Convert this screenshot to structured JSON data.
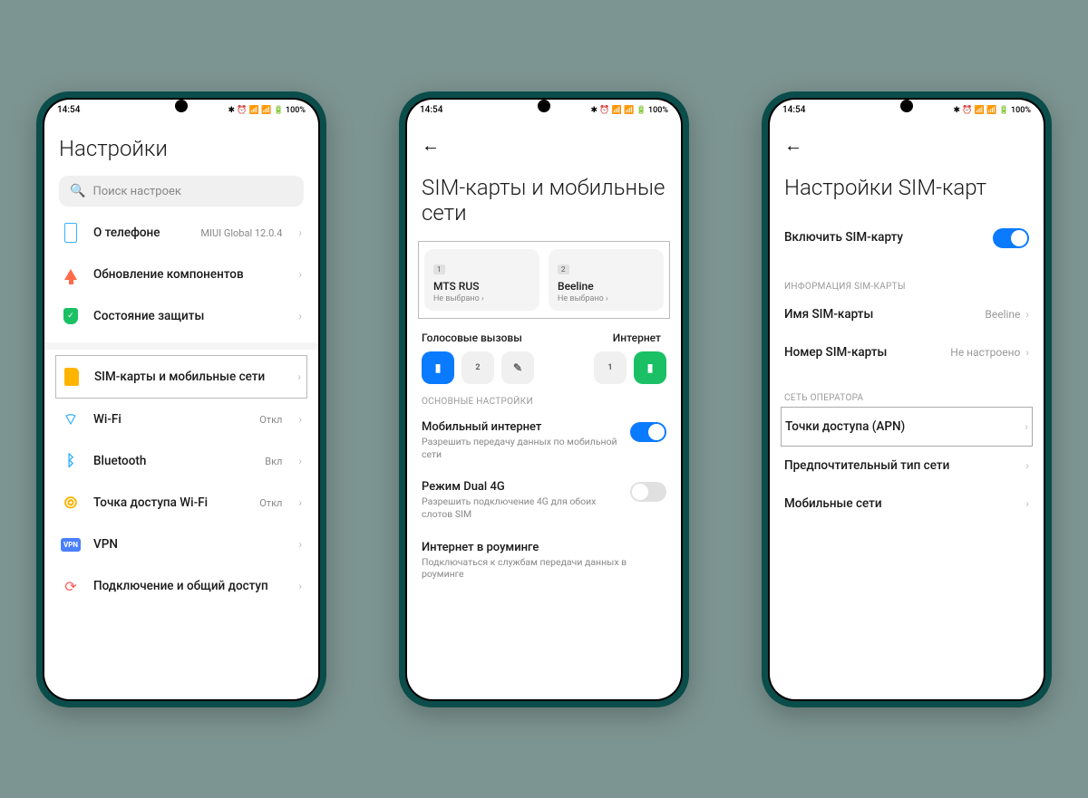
{
  "status": {
    "time": "14:54",
    "right": "✱ ⏰ 📶 📶 🔋 100%"
  },
  "screen1": {
    "title": "Настройки",
    "search_placeholder": "Поиск настроек",
    "items": [
      {
        "label": "О телефоне",
        "sub": "MIUI Global 12.0.4"
      },
      {
        "label": "Обновление компонентов",
        "sub": ""
      },
      {
        "label": "Состояние защиты",
        "sub": ""
      },
      {
        "label": "SIM-карты и мобильные сети",
        "sub": ""
      },
      {
        "label": "Wi-Fi",
        "sub": "Откл"
      },
      {
        "label": "Bluetooth",
        "sub": "Вкл"
      },
      {
        "label": "Точка доступа Wi-Fi",
        "sub": "Откл"
      },
      {
        "label": "VPN",
        "sub": ""
      },
      {
        "label": "Подключение и общий доступ",
        "sub": ""
      }
    ]
  },
  "screen2": {
    "title": "SIM-карты и мобильные сети",
    "sims": [
      {
        "num": "1",
        "name": "MTS RUS",
        "sel": "Не выбрано"
      },
      {
        "num": "2",
        "name": "Beeline",
        "sel": "Не выбрано"
      }
    ],
    "col1": "Голосовые вызовы",
    "col2": "Интернет",
    "sect": "ОСНОВНЫЕ НАСТРОЙКИ",
    "rows": [
      {
        "title": "Мобильный интернет",
        "desc": "Разрешить передачу данных по мобильной сети",
        "on": true
      },
      {
        "title": "Режим Dual 4G",
        "desc": "Разрешить подключение 4G для обоих слотов SIM",
        "on": false
      },
      {
        "title": "Интернет в роуминге",
        "desc": "Подключаться к службам передачи данных в роуминге",
        "on": null
      }
    ]
  },
  "screen3": {
    "title": "Настройки SIM-карт",
    "enable_label": "Включить SIM-карту",
    "sect1": "ИНФОРМАЦИЯ SIM-КАРТЫ",
    "rows1": [
      {
        "label": "Имя SIM-карты",
        "val": "Beeline"
      },
      {
        "label": "Номер SIM-карты",
        "val": "Не настроено"
      }
    ],
    "sect2": "СЕТЬ ОПЕРАТОРА",
    "rows2": [
      {
        "label": "Точки доступа (APN)"
      },
      {
        "label": "Предпочтительный тип сети"
      },
      {
        "label": "Мобильные сети"
      }
    ]
  }
}
